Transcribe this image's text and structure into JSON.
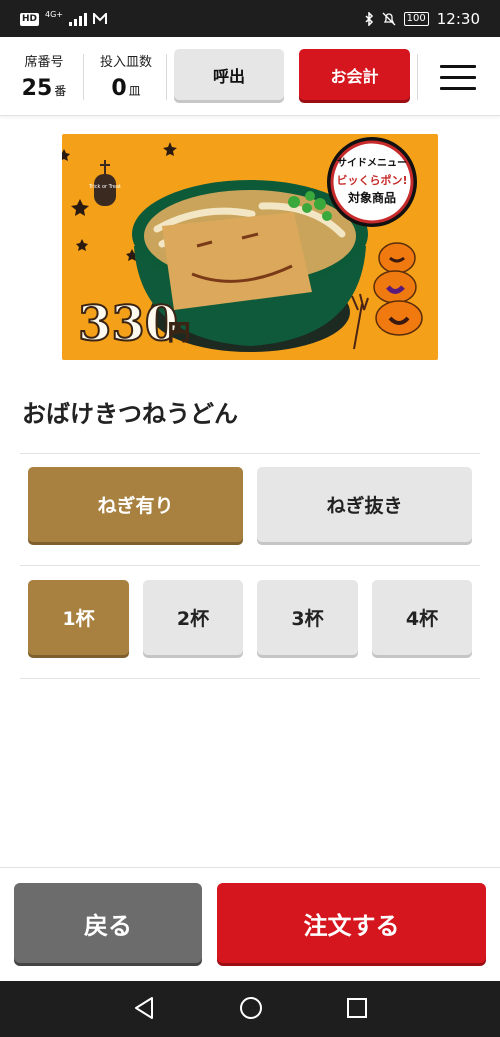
{
  "status_bar": {
    "hd": "HD",
    "network": "4G+",
    "time": "12:30",
    "battery": "100"
  },
  "header": {
    "seat_label": "席番号",
    "seat_number": "25",
    "seat_unit": "番",
    "plates_label": "投入皿数",
    "plates_count": "0",
    "plates_unit": "皿",
    "call_button": "呼出",
    "checkout_button": "お会計"
  },
  "banner": {
    "price": "330",
    "price_unit": "円",
    "badge_line1": "サイドメニュー",
    "badge_line2": "ビッくらポン!",
    "badge_line3": "対象商品",
    "sign_text": "Trick or Treat"
  },
  "product": {
    "name": "おばけきつねうどん"
  },
  "options": {
    "negi": [
      {
        "label": "ねぎ有り",
        "selected": true
      },
      {
        "label": "ねぎ抜き",
        "selected": false
      }
    ],
    "quantity": [
      {
        "label": "1杯",
        "selected": true
      },
      {
        "label": "2杯",
        "selected": false
      },
      {
        "label": "3杯",
        "selected": false
      },
      {
        "label": "4杯",
        "selected": false
      }
    ]
  },
  "footer": {
    "back_button": "戻る",
    "order_button": "注文する"
  },
  "colors": {
    "accent_red": "#d5161f",
    "selected_brown": "#a8803f",
    "banner_orange": "#f4a019"
  }
}
